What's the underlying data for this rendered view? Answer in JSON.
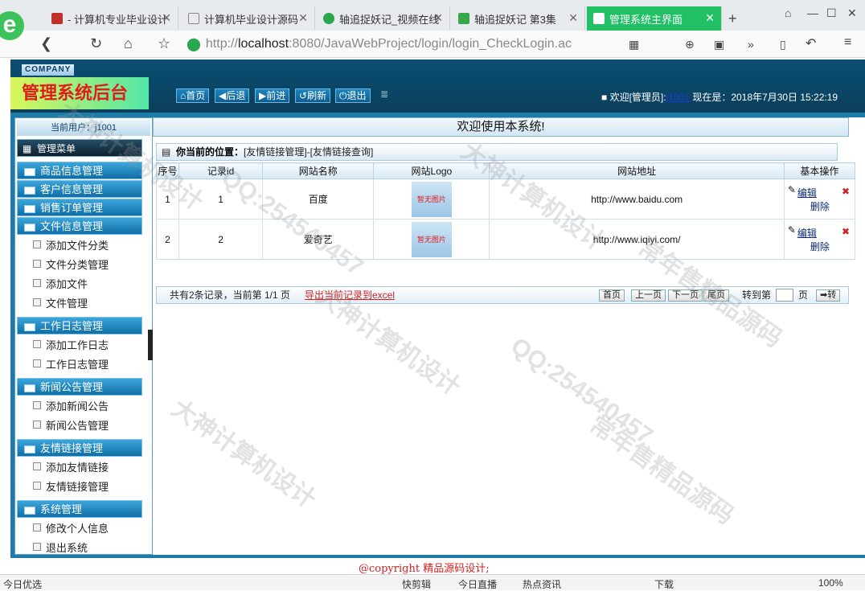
{
  "browser": {
    "tabs": [
      {
        "label": "- 计算机专业毕业设计"
      },
      {
        "label": "计算机毕业设计源码"
      },
      {
        "label": "轴追捉妖记_视频在线"
      },
      {
        "label": "轴追捉妖记 第3集"
      },
      {
        "label": "管理系统主界面"
      }
    ],
    "url_prefix": "http://",
    "url_host": "localhost",
    "url_rest": ":8080/JavaWebProject/login/login_CheckLogin.ac",
    "status_left": "今日优选",
    "status_items": [
      "快剪辑",
      "今日直播",
      "热点资讯",
      "下载",
      "100%"
    ]
  },
  "header": {
    "company": "COMPANY",
    "title": "管理系统后台",
    "buttons": {
      "home": "首页",
      "back": "后退",
      "forward": "前进",
      "refresh": "刷新",
      "logout": "退出"
    },
    "welcome_prefix": "欢迎[管理员]:",
    "welcome_user": "j1001",
    "now_label": "现在是：2018年7月30日 15:22:19"
  },
  "sidebar": {
    "current_user": "当前用户：j1001",
    "menu_head": "管理菜单",
    "groups": [
      {
        "label": "商品信息管理"
      },
      {
        "label": "客户信息管理"
      },
      {
        "label": "销售订单管理"
      },
      {
        "label": "文件信息管理",
        "items": [
          "添加文件分类",
          "文件分类管理",
          "添加文件",
          "文件管理"
        ]
      },
      {
        "label": "工作日志管理",
        "items": [
          "添加工作日志",
          "工作日志管理"
        ]
      },
      {
        "label": "新闻公告管理",
        "items": [
          "添加新闻公告",
          "新闻公告管理"
        ]
      },
      {
        "label": "友情链接管理",
        "items": [
          "添加友情链接",
          "友情链接管理"
        ]
      },
      {
        "label": "系统管理",
        "items": [
          "修改个人信息",
          "退出系统"
        ]
      }
    ]
  },
  "main": {
    "welcome": "欢迎使用本系统!",
    "position_label": "你当前的位置：",
    "position_path": "[友情链接管理]-[友情链接查询]",
    "columns": [
      "序号",
      "记录id",
      "网站名称",
      "网站Logo",
      "网站地址",
      "基本操作"
    ],
    "rows": [
      {
        "no": "1",
        "id": "1",
        "name": "百度",
        "logo": "暂无图片",
        "url": "http://www.baidu.com",
        "edit": "编辑",
        "delete": "删除"
      },
      {
        "no": "2",
        "id": "2",
        "name": "爱奇艺",
        "logo": "暂无图片",
        "url": "http://www.iqiyi.com/",
        "edit": "编辑",
        "delete": "删除"
      }
    ],
    "pager": {
      "summary": "共有2条记录，当前第 1/1 页",
      "export": "导出当前记录到excel",
      "first": "首页",
      "prev": "上一页",
      "next": "下一页",
      "last": "尾页",
      "goto_label": "转到第",
      "page_unit": "页",
      "go": "转"
    }
  },
  "footer": {
    "copyright": "@copyright 精品源码设计;"
  },
  "watermarks": [
    "大神计算机设计",
    "QQ:254540457",
    "常年售精品源码"
  ]
}
